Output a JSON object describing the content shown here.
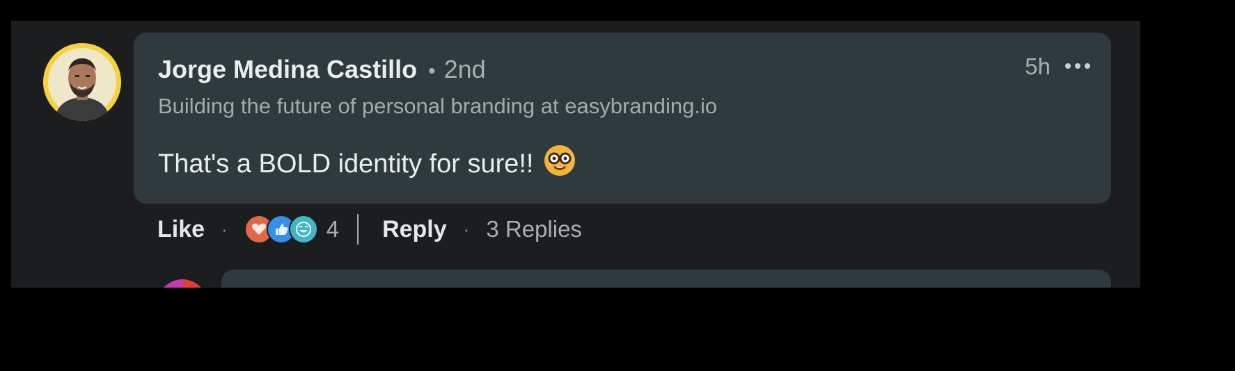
{
  "comment": {
    "author": "Jorge Medina Castillo",
    "separator": "•",
    "connection_degree": "2nd",
    "headline": "Building the future of personal branding at easybranding.io",
    "timestamp": "5h",
    "more_icon": "ellipsis-icon",
    "text": "That's a BOLD identity for sure!!",
    "emoji": "nerd-face-emoji"
  },
  "actions": {
    "like_label": "Like",
    "dot": "·",
    "reactions": [
      {
        "icon": "love-reaction-icon",
        "color": "#e06847"
      },
      {
        "icon": "like-reaction-icon",
        "color": "#378fe9"
      },
      {
        "icon": "funny-reaction-icon",
        "color": "#44b5c4"
      }
    ],
    "reaction_count": "4",
    "reply_label": "Reply",
    "replies_label": "3 Replies"
  },
  "colors": {
    "background": "#1c1d1f",
    "bubble": "#2e3a3b",
    "avatar_ring": "#f5d33a"
  }
}
